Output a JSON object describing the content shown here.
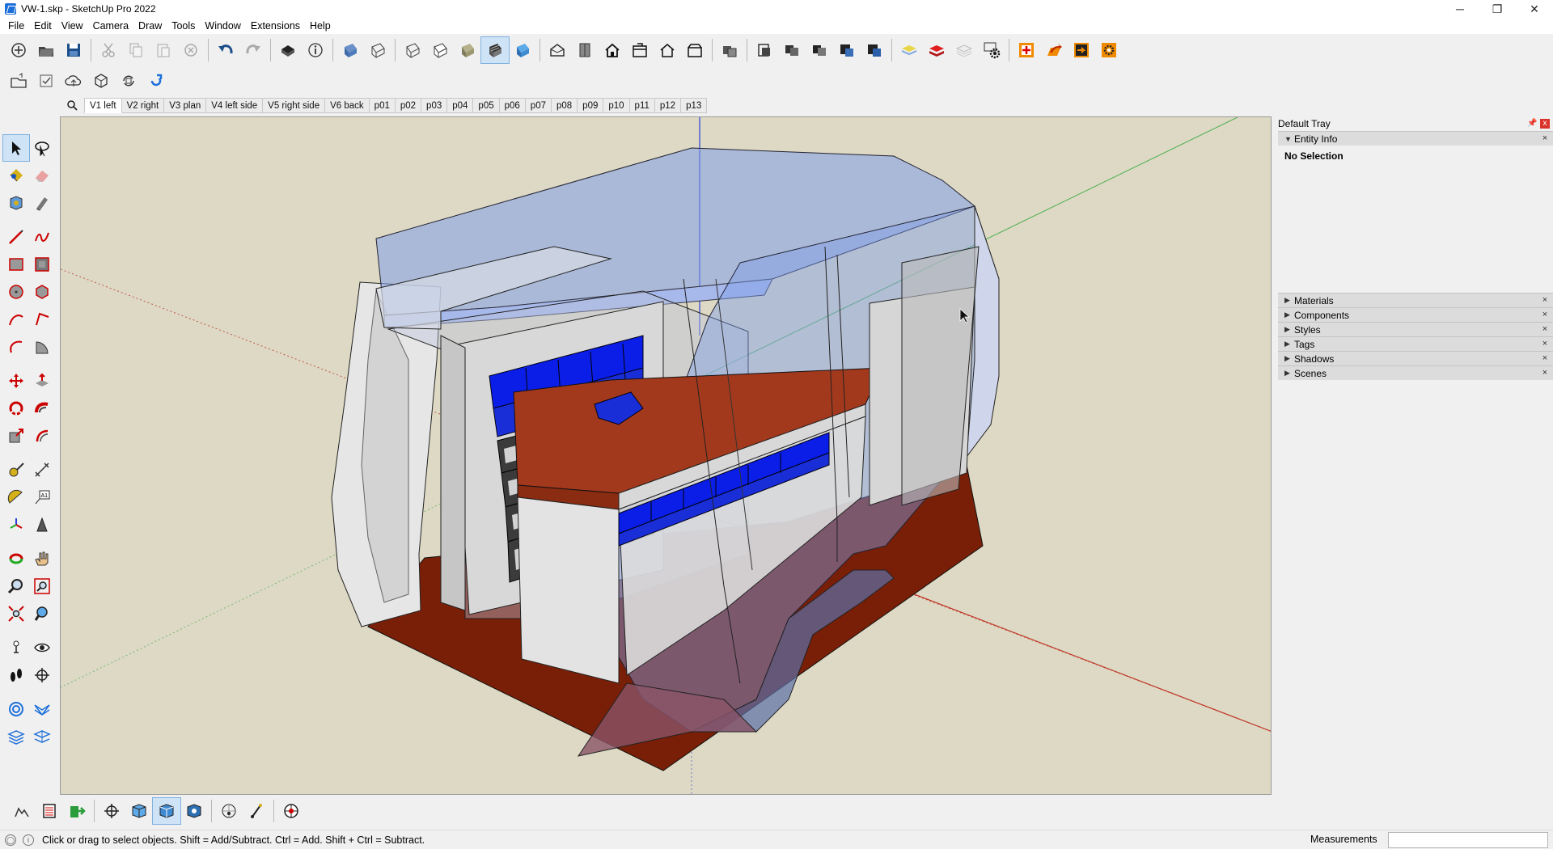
{
  "window": {
    "title": "VW-1.skp - SketchUp Pro 2022",
    "minimize": "─",
    "maximize": "❐",
    "close": "✕"
  },
  "menu": [
    "File",
    "Edit",
    "View",
    "Camera",
    "Draw",
    "Tools",
    "Window",
    "Extensions",
    "Help"
  ],
  "scenes": {
    "active": "V1 left",
    "tabs": [
      "V1 left",
      "V2 right",
      "V3 plan",
      "V4 left side",
      "V5 right side",
      "V6 back",
      "p01",
      "p02",
      "p03",
      "p04",
      "p05",
      "p06",
      "p07",
      "p08",
      "p09",
      "p10",
      "p11",
      "p12",
      "p13"
    ]
  },
  "tray": {
    "title": "Default Tray",
    "pin": "📌",
    "close": "x",
    "entity_info": {
      "title": "Entity Info",
      "selection": "No Selection"
    },
    "panels": [
      "Materials",
      "Components",
      "Styles",
      "Tags",
      "Shadows",
      "Scenes"
    ]
  },
  "status": {
    "hint": "Click or drag to select objects. Shift = Add/Subtract. Ctrl = Add. Shift + Ctrl = Subtract.",
    "measurements_label": "Measurements",
    "measurements_value": ""
  },
  "colors": {
    "viewport_bg": "#ddd9c4",
    "floor": "#7a1f07",
    "bins": "#0a1ee8",
    "glass": "#7f9ee8",
    "axis_red": "#c0392b",
    "axis_green": "#4caf50",
    "axis_blue": "#2a3ed6",
    "accent": "#1e6fd9"
  },
  "icons": {
    "toolbar1": [
      "new-icon",
      "open-icon",
      "save-icon",
      "cut-icon",
      "copy-icon",
      "paste-icon",
      "erase-icon",
      "undo-icon",
      "redo-icon",
      "print-icon",
      "model-info-icon",
      "xray-icon",
      "back-edges-icon",
      "wireframe-icon",
      "hidden-line-icon",
      "shaded-icon",
      "shaded-textures-icon",
      "monochrome-icon",
      "iso-view-icon",
      "top-view-icon",
      "front-view-icon",
      "right-view-icon",
      "back-view-icon",
      "left-view-icon",
      "component-a-icon",
      "section-plane-icon",
      "section-fill-icon",
      "section-cut-icon",
      "section-display-icon",
      "section-toggle-icon",
      "tag-yellow-icon",
      "tag-red-icon",
      "tag-white-icon",
      "settings-gear-icon",
      "ext-add-icon",
      "ext-arrow-icon",
      "ext-push-icon",
      "ext-gear-icon"
    ],
    "toolbar2": [
      "warehouse-icon",
      "check-icon",
      "cloud-upload-icon",
      "ext-warehouse-icon",
      "refresh-icon",
      "sync-icon"
    ]
  }
}
